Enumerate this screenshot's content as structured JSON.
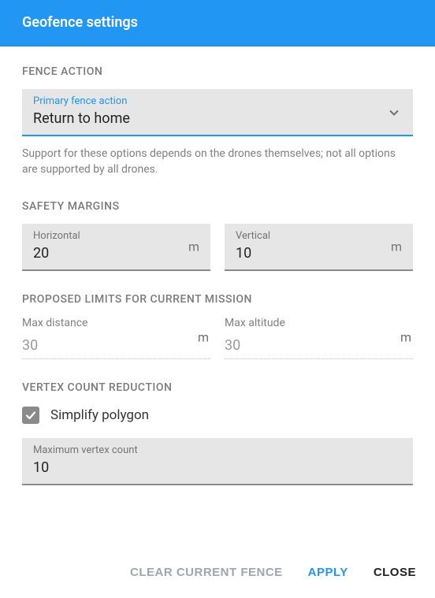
{
  "header": {
    "title": "Geofence settings"
  },
  "fence_action": {
    "section_label": "FENCE ACTION",
    "float_label": "Primary fence action",
    "value": "Return to home",
    "helper": "Support for these options depends on the drones themselves; not all options are supported by all drones."
  },
  "safety_margins": {
    "section_label": "SAFETY MARGINS",
    "horizontal": {
      "label": "Horizontal",
      "value": "20",
      "unit": "m"
    },
    "vertical": {
      "label": "Vertical",
      "value": "10",
      "unit": "m"
    }
  },
  "proposed_limits": {
    "section_label": "PROPOSED LIMITS FOR CURRENT MISSION",
    "max_distance": {
      "label": "Max distance",
      "value": "30",
      "unit": "m"
    },
    "max_altitude": {
      "label": "Max altitude",
      "value": "30",
      "unit": "m"
    }
  },
  "vertex_reduction": {
    "section_label": "VERTEX COUNT REDUCTION",
    "simplify_label": "Simplify polygon",
    "simplify_checked": true,
    "max_vertex": {
      "label": "Maximum vertex count",
      "value": "10"
    }
  },
  "actions": {
    "clear": "CLEAR CURRENT FENCE",
    "apply": "APPLY",
    "close": "CLOSE"
  }
}
